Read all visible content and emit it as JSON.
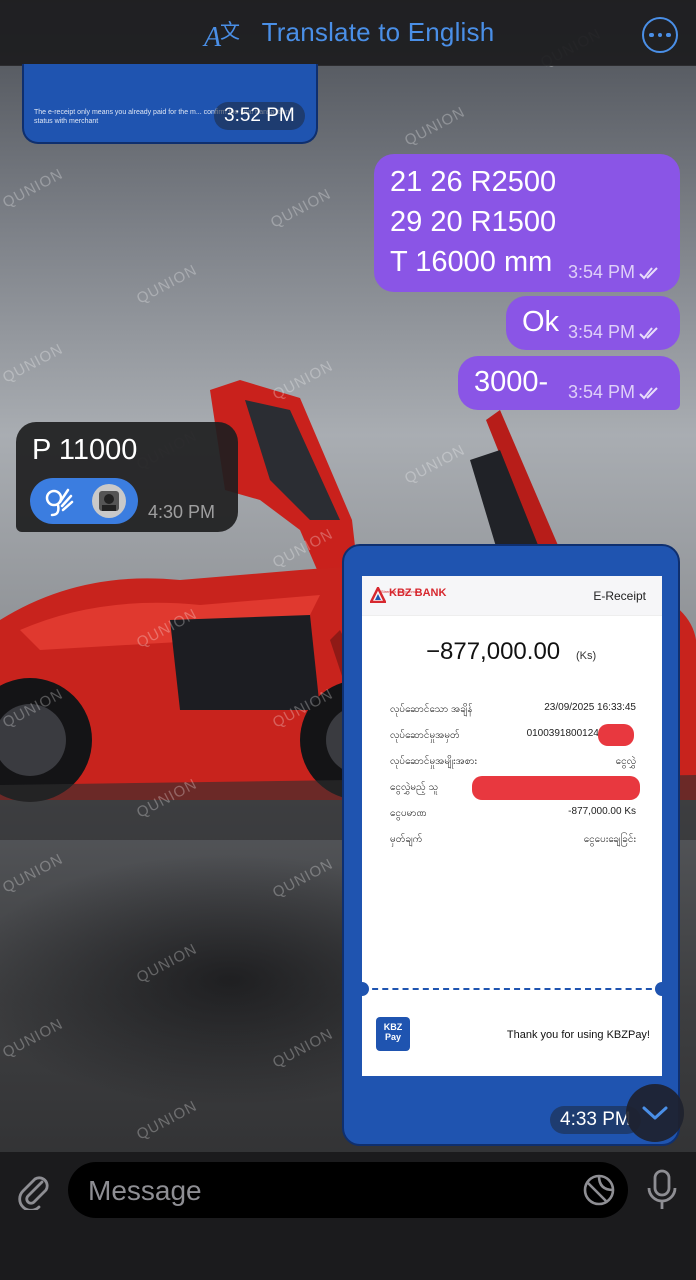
{
  "header": {
    "translate_label": "Translate to English",
    "translate_icon": "translate-icon",
    "more_icon": "more-icon"
  },
  "messages": {
    "prev_receipt_note": "The e-receipt only means you already paid for the m... confirm the final transaction status with merchant",
    "prev_time": "3:52 PM",
    "out1_lines": [
      "21 26 R2500",
      "29 20 R1500",
      "T 16000 mm"
    ],
    "out1_time": "3:54 PM",
    "out2_text": "Ok",
    "out2_time": "3:54 PM",
    "out3_text": "3000-",
    "out3_time": "3:54 PM",
    "in1_text": "P 11000",
    "in1_time": "4:30 PM",
    "in1_reaction": "ok-hand-emoji",
    "receipt_time": "4:33 PM"
  },
  "receipt": {
    "bank_name": "KBZ BANK",
    "bank_tagline": "Strength of Myanmar",
    "title": "E-Receipt",
    "amount": "−877,000.00",
    "unit": "(Ks)",
    "rows": [
      {
        "label": "လုပ်ဆောင်သော အချိန်",
        "value": "23/09/2025 16:33:45"
      },
      {
        "label": "လုပ်ဆောင်မှုအမှတ်",
        "value": "010039180012495"
      },
      {
        "label": "လုပ်ဆောင်မှုအမျိုးအစား",
        "value": "ငွေလွှဲ"
      },
      {
        "label": "ငွေလွှဲမည့် သူ",
        "value": ""
      },
      {
        "label": "ငွေပမာဏ",
        "value": "-877,000.00 Ks"
      },
      {
        "label": "မှတ်ချက်",
        "value": "ငွေပေးချေခြင်း"
      }
    ],
    "pay_logo": "KBZ Pay",
    "thanks": "Thank you for using KBZPay!"
  },
  "watermark": "QUNION",
  "input": {
    "placeholder": "Message",
    "attach_icon": "paperclip-icon",
    "sticker_icon": "sticker-icon",
    "mic_icon": "microphone-icon"
  },
  "colors": {
    "outgoing_bubble": "#8a55e6",
    "incoming_bubble": "#1e1e20",
    "accent": "#4a8fe7",
    "kbz_blue": "#1f54b0",
    "kbz_red": "#d7282f"
  }
}
